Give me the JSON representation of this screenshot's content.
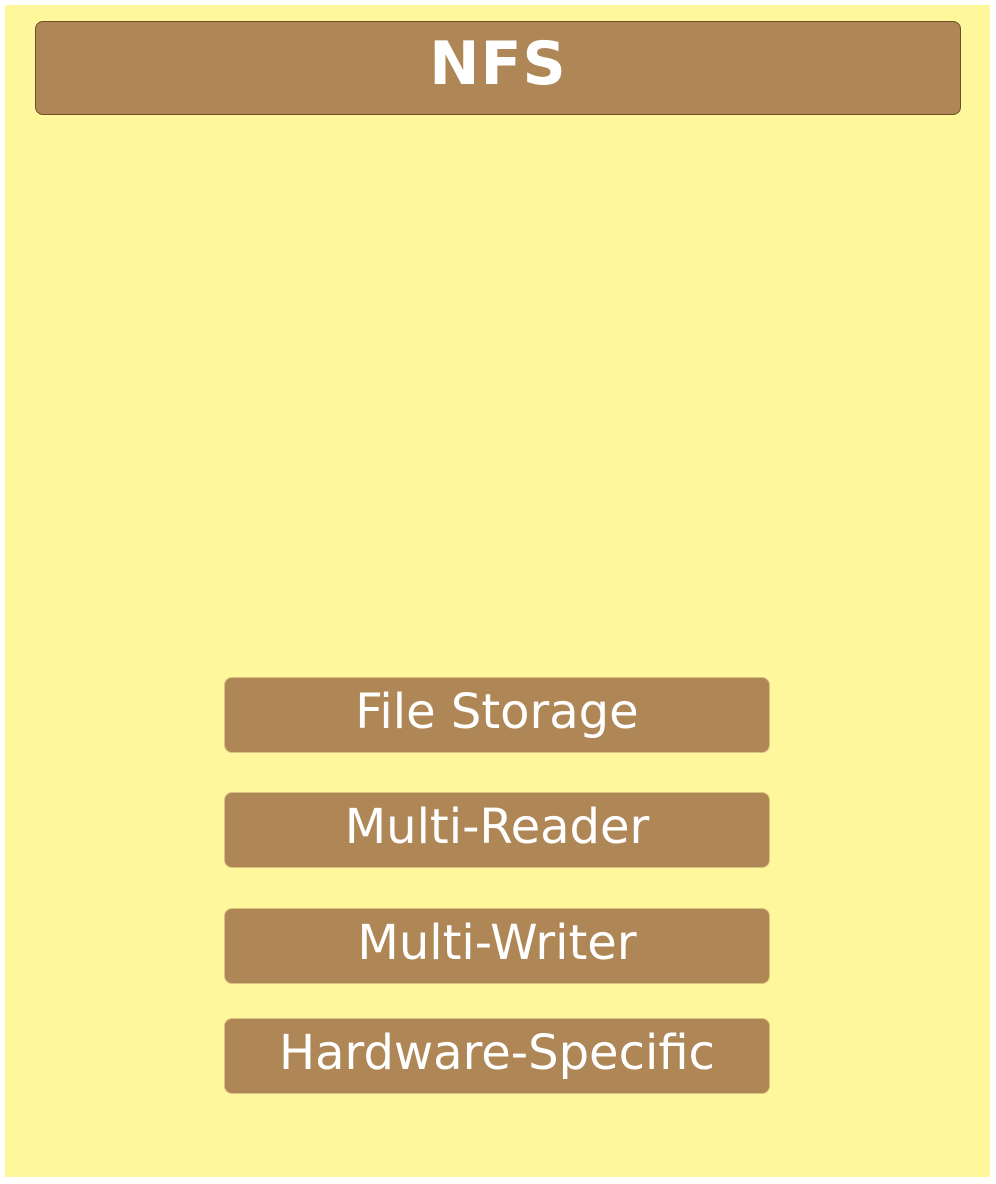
{
  "title": "NFS",
  "features": [
    "File Storage",
    "Multi-Reader",
    "Multi-Writer",
    "Hardware-Specific"
  ],
  "colors": {
    "background": "#fff79b",
    "box_fill": "#af8656",
    "text": "#ffffff"
  }
}
